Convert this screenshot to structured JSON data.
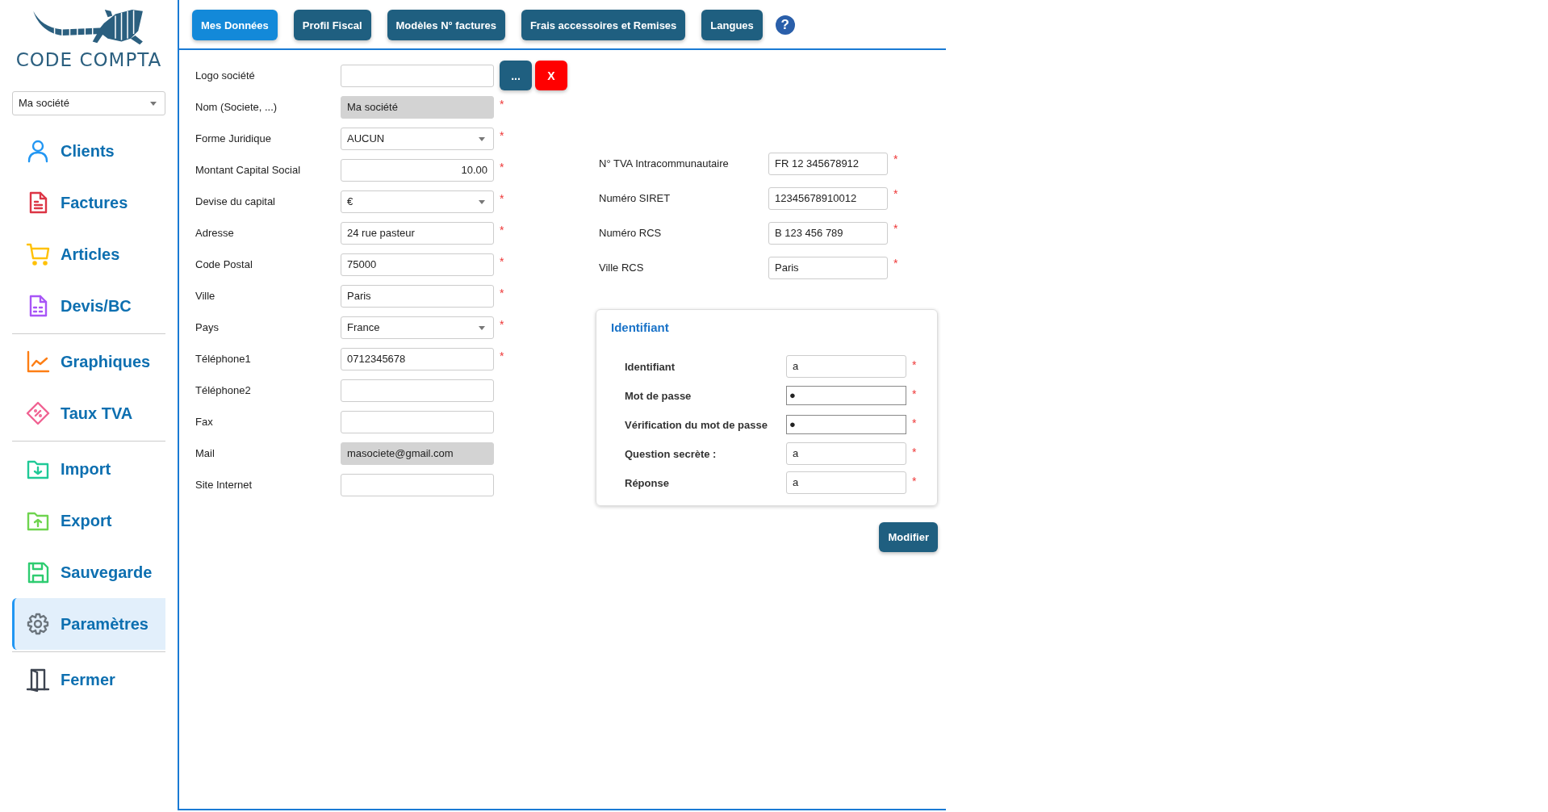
{
  "sidebar": {
    "logo_text": "CODE COMPTA",
    "company_select": "Ma société",
    "groups": [
      {
        "items": [
          {
            "label": "Clients",
            "kind": "user",
            "selected": false
          },
          {
            "label": "Factures",
            "kind": "invoice",
            "selected": false
          },
          {
            "label": "Articles",
            "kind": "cart",
            "selected": false
          },
          {
            "label": "Devis/BC",
            "kind": "quote",
            "selected": false
          }
        ]
      },
      {
        "items": [
          {
            "label": "Graphiques",
            "kind": "chart",
            "selected": false
          },
          {
            "label": "Taux TVA",
            "kind": "tag",
            "selected": false
          }
        ]
      },
      {
        "items": [
          {
            "label": "Import",
            "kind": "import",
            "selected": false
          },
          {
            "label": "Export",
            "kind": "export",
            "selected": false
          },
          {
            "label": "Sauvegarde",
            "kind": "save",
            "selected": false
          },
          {
            "label": "Paramètres",
            "kind": "gear",
            "selected": true
          }
        ]
      },
      {
        "items": [
          {
            "label": "Fermer",
            "kind": "door",
            "selected": false
          }
        ]
      }
    ]
  },
  "tabs": [
    {
      "label": "Mes Données",
      "selected": true
    },
    {
      "label": "Profil Fiscal",
      "selected": false
    },
    {
      "label": "Modèles N° factures",
      "selected": false
    },
    {
      "label": "Frais accessoires et Remises",
      "selected": false
    },
    {
      "label": "Langues",
      "selected": false
    }
  ],
  "help_label": "?",
  "required_symbol": "*",
  "logo_field": {
    "label": "Logo société",
    "browse": "...",
    "clear": "X"
  },
  "left_fields": [
    {
      "label": "Nom (Societe, ...)",
      "value": "Ma société",
      "kind": "readonly",
      "required": true
    },
    {
      "label": "Forme Juridique",
      "value": "AUCUN",
      "kind": "select",
      "required": true
    },
    {
      "label": "Montant Capital Social",
      "value": "10.00",
      "kind": "number",
      "required": true
    },
    {
      "label": "Devise du capital",
      "value": "€",
      "kind": "select",
      "required": true
    },
    {
      "label": "Adresse",
      "value": "24 rue pasteur",
      "kind": "text",
      "required": true
    },
    {
      "label": "Code Postal",
      "value": "75000",
      "kind": "text",
      "required": true
    },
    {
      "label": "Ville",
      "value": "Paris",
      "kind": "text",
      "required": true
    },
    {
      "label": "Pays",
      "value": "France",
      "kind": "select",
      "required": true
    },
    {
      "label": "Téléphone1",
      "value": "0712345678",
      "kind": "text",
      "required": true
    },
    {
      "label": "Téléphone2",
      "kind": "text",
      "required": false
    },
    {
      "label": "Fax",
      "kind": "text",
      "required": false
    },
    {
      "label": "Mail",
      "value": "masociete@gmail.com",
      "kind": "readonly",
      "required": false
    },
    {
      "label": "Site Internet",
      "kind": "text",
      "required": false
    }
  ],
  "right_fields": [
    {
      "label": "N° TVA Intracommunautaire",
      "value": "FR 12 345678912",
      "required": true
    },
    {
      "label": "Numéro SIRET",
      "value": "12345678910012",
      "required": true
    },
    {
      "label": "Numéro RCS",
      "value": "B 123 456 789",
      "required": true
    },
    {
      "label": "Ville RCS",
      "value": "Paris",
      "required": true
    }
  ],
  "credentials": {
    "title": "Identifiant",
    "fields": [
      {
        "label": "Identifiant",
        "value": "a",
        "kind": "text",
        "required": true
      },
      {
        "label": "Mot de passe",
        "value": "●",
        "kind": "password",
        "required": true
      },
      {
        "label": "Vérification du mot de passe",
        "value": "●",
        "kind": "password",
        "required": true
      },
      {
        "label": "Question secrète :",
        "value": "a",
        "kind": "text",
        "required": true
      },
      {
        "label": "Réponse",
        "value": "a",
        "kind": "text",
        "required": true
      }
    ]
  },
  "submit": "Modifier"
}
